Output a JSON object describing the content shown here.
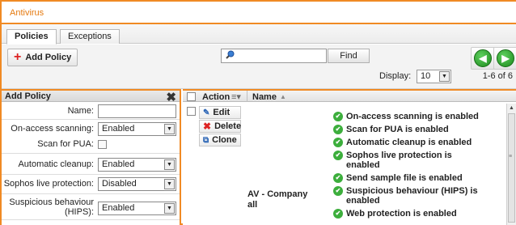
{
  "window": {
    "title": "Antivirus"
  },
  "tabs": [
    {
      "label": "Policies"
    },
    {
      "label": "Exceptions"
    }
  ],
  "toolbar": {
    "add_policy": "Add Policy",
    "search_placeholder": "",
    "find": "Find",
    "display_label": "Display:",
    "display_value": "10",
    "pager": "1-6 of 6",
    "prev_icon": "left-arrow-icon",
    "next_icon": "right-arrow-icon"
  },
  "left_panel": {
    "title": "Add Policy",
    "fields": {
      "name_label": "Name:",
      "name_value": "",
      "onaccess_label": "On-access scanning:",
      "onaccess_value": "Enabled",
      "pua_label": "Scan for PUA:",
      "cleanup_label": "Automatic cleanup:",
      "cleanup_value": "Enabled",
      "live_label": "Sophos live protection:",
      "live_value": "Disabled",
      "hips_label_1": "Suspicious behaviour",
      "hips_label_2": "(HIPS):",
      "hips_value": "Enabled"
    }
  },
  "grid": {
    "col_action": "Action",
    "col_name": "Name",
    "actions": {
      "edit": "Edit",
      "delete": "Delete",
      "clone": "Clone"
    },
    "row": {
      "name_1": "AV - Company",
      "name_2": "all",
      "statuses": [
        [
          "On-access scanning is enabled"
        ],
        [
          "Scan for PUA is enabled"
        ],
        [
          "Automatic cleanup is enabled"
        ],
        [
          "Sophos live protection is",
          "enabled"
        ],
        [
          "Send sample file is enabled"
        ],
        [
          "Suspicious behaviour (HIPS) is",
          "enabled"
        ],
        [
          "Web protection is enabled"
        ]
      ]
    }
  },
  "colors": {
    "accent": "#f08a24",
    "ok": "#3cae3c",
    "delete": "#dd2222",
    "nav": "#2a9a2a"
  }
}
